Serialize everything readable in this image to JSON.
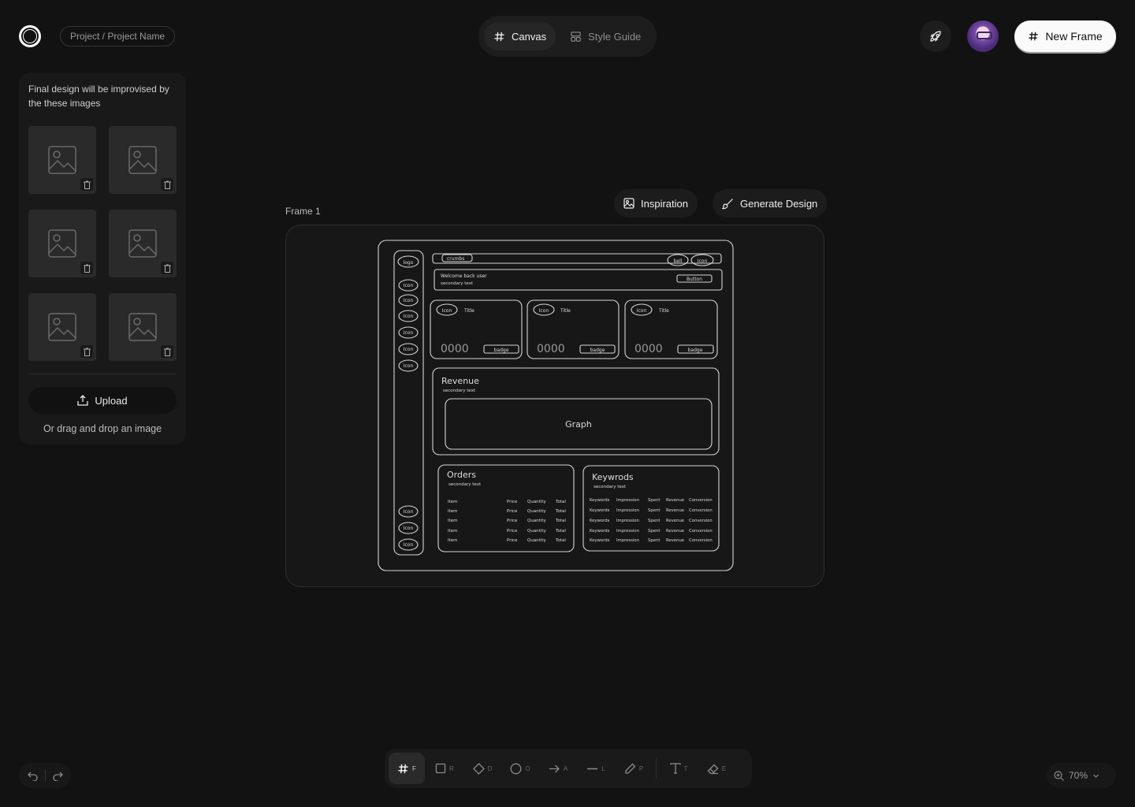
{
  "header": {
    "breadcrumb": "Project / Project Name",
    "tabs": [
      {
        "label": "Canvas",
        "icon": "hash-icon",
        "active": true
      },
      {
        "label": "Style Guide",
        "icon": "layout-icon",
        "active": false
      }
    ],
    "new_frame_label": "New Frame"
  },
  "panel": {
    "note": "Final design will be improvised by the these images",
    "image_count": 6,
    "upload_label": "Upload",
    "drag_text": "Or drag and drop an image"
  },
  "frame": {
    "label": "Frame 1",
    "inspiration_label": "Inspiration",
    "generate_label": "Generate Design",
    "sketch": {
      "logo": "logo",
      "icon": "Icon",
      "crumbs": "crumbs",
      "bell": "bell",
      "welcome": "Welcome back user",
      "secondary": "secondary text",
      "button": "Button",
      "card_title": "Title",
      "card_value": "0000",
      "badge": "badge",
      "revenue": "Revenue",
      "graph": "Graph",
      "orders": "Orders",
      "orders_row": [
        "Item",
        "Price",
        "Quantity",
        "Total"
      ],
      "keywords": "Keywrods",
      "keywords_row": [
        "Keywords",
        "Impression",
        "Spent",
        "Revenue",
        "Conversion"
      ]
    }
  },
  "toolbar": {
    "tools": [
      {
        "name": "frame",
        "key": "F",
        "active": true
      },
      {
        "name": "rectangle",
        "key": "R"
      },
      {
        "name": "diamond",
        "key": "D"
      },
      {
        "name": "ellipse",
        "key": "O"
      },
      {
        "name": "arrow",
        "key": "A"
      },
      {
        "name": "line",
        "key": "L"
      },
      {
        "name": "pencil",
        "key": "P"
      },
      {
        "name": "text",
        "key": "T"
      },
      {
        "name": "eraser",
        "key": "E"
      }
    ]
  },
  "zoom": {
    "value": "70%"
  }
}
